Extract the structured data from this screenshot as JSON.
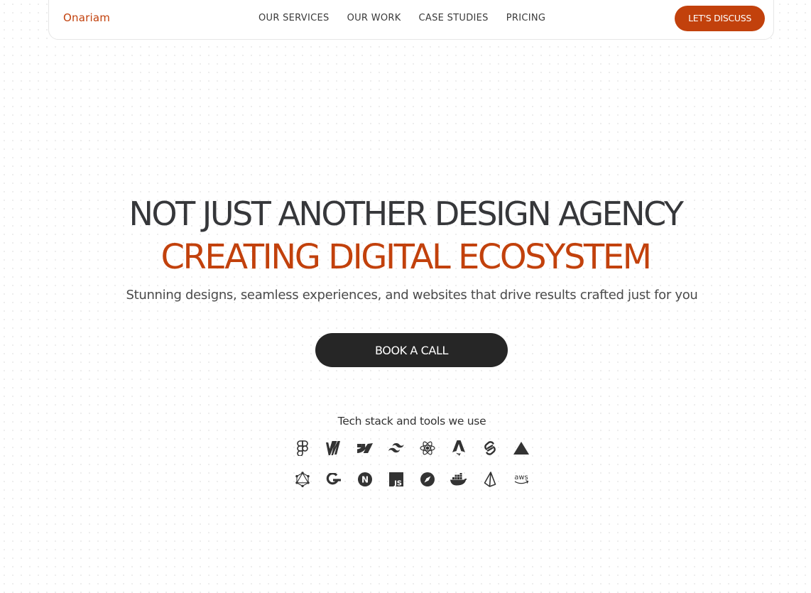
{
  "header": {
    "logo": "Onariam",
    "nav": [
      "OUR SERVICES",
      "OUR WORK",
      "CASE STUDIES",
      "PRICING"
    ],
    "cta": "LET'S DISCUSS"
  },
  "hero": {
    "line1": "NOT JUST ANOTHER DESIGN AGENCY",
    "line2": "CREATING DIGITAL ECOSYSTEM",
    "subtitle": "Stunning designs, seamless experiences, and websites that drive results crafted just for you",
    "button": "BOOK A CALL"
  },
  "tech": {
    "heading": "Tech stack and tools we use",
    "row1": [
      "figma-icon",
      "miro-icon",
      "webflow-icon",
      "tailwind-icon",
      "react-icon",
      "astro-icon",
      "svelte-icon",
      "vercel-icon"
    ],
    "row2": [
      "graphql-icon",
      "gatsby-icon",
      "nextjs-icon",
      "javascript-icon",
      "safari-icon",
      "docker-icon",
      "prisma-icon",
      "aws-icon"
    ],
    "aws_text": "aws",
    "js_text": "JS",
    "next_text": "N"
  },
  "colors": {
    "accent": "#c2410c",
    "dark": "#262626",
    "heading": "#36373a"
  }
}
